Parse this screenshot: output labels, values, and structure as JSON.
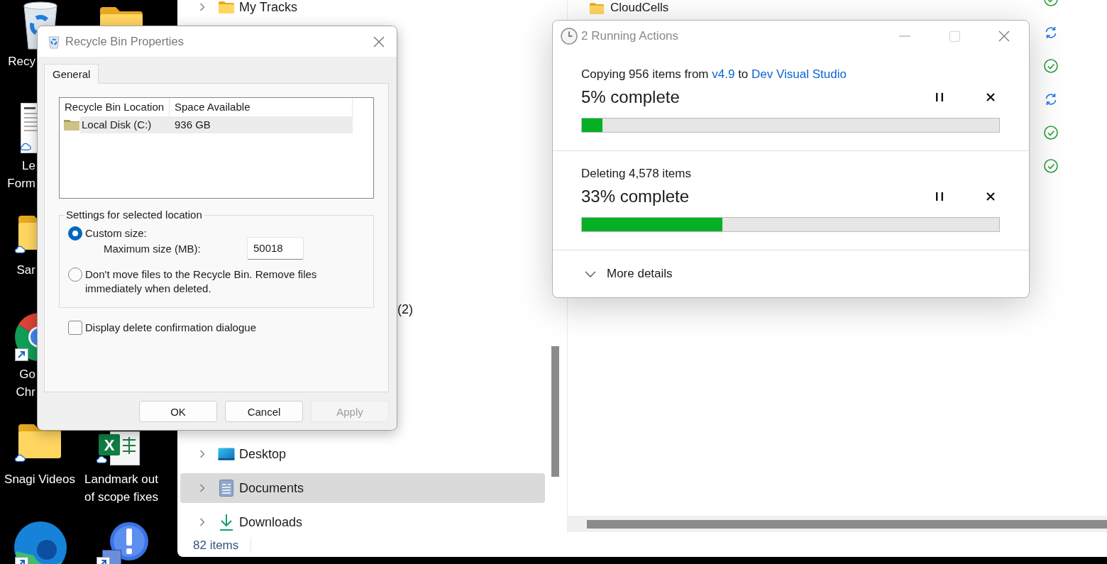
{
  "desktop": {
    "icons": [
      {
        "kind": "recycle-bin",
        "label": "Recy",
        "cloud": false,
        "shortcut": false
      },
      {
        "kind": "folder",
        "cloud": false,
        "shortcut": false
      },
      {
        "kind": "document",
        "label": "Le Form",
        "cloud": true,
        "shortcut": false
      },
      {
        "kind": "folder",
        "label": "Sar",
        "cloud": true,
        "shortcut": false
      },
      {
        "kind": "browser",
        "label": "Go Chr",
        "cloud": false,
        "shortcut": true
      },
      {
        "kind": "folder",
        "label": "Snagi Videos",
        "cloud": true,
        "shortcut": false
      },
      {
        "kind": "spreadsheet",
        "logo_text": "X",
        "label": "Landmark out of scope fixes",
        "cloud": true,
        "shortcut": false
      },
      {
        "kind": "edge",
        "cloud": false,
        "shortcut": true
      },
      {
        "kind": "alert",
        "cloud": false,
        "shortcut": true
      }
    ]
  },
  "explorer": {
    "nav_items": [
      {
        "kind": "folder",
        "label": "My Tracks",
        "selected": false
      },
      {
        "kind": "partial",
        "label": "(2)",
        "selected": false
      },
      {
        "kind": "desktop",
        "label": "Desktop",
        "selected": false
      },
      {
        "kind": "documents",
        "label": "Documents",
        "selected": true
      },
      {
        "kind": "downloads",
        "label": "Downloads",
        "selected": false
      }
    ],
    "files": [
      {
        "name": "CloudCells",
        "syncing": false
      },
      {
        "syncing": true
      },
      {
        "syncing": false
      },
      {
        "syncing": true
      },
      {
        "syncing": false
      },
      {
        "syncing": false
      }
    ],
    "status_bar": {
      "item_count": "82 items"
    }
  },
  "recycle_bin_properties": {
    "title": "Recycle Bin Properties",
    "tabs": [
      {
        "label": "General",
        "selected": true
      }
    ],
    "locations": {
      "columns": [
        "Recycle Bin Location",
        "Space Available"
      ],
      "rows": [
        {
          "cells": [
            "Local Disk (C:)",
            "936 GB"
          ],
          "selected": true
        }
      ]
    },
    "settings": {
      "legend": "Settings for selected location",
      "options": [
        {
          "label": "Custom size:",
          "selected": true
        },
        {
          "label": "Don't move files to the Recycle Bin. Remove files immediately when deleted.",
          "selected": false
        }
      ],
      "max_size": {
        "label": "Maximum size (MB):",
        "value": "50018"
      }
    },
    "confirm_checkbox": {
      "label": "Display delete confirmation dialogue",
      "checked": false
    },
    "buttons": [
      {
        "label": "OK",
        "disabled": false
      },
      {
        "label": "Cancel",
        "disabled": false
      },
      {
        "label": "Apply",
        "disabled": true
      }
    ]
  },
  "running_actions": {
    "title": "2 Running Actions",
    "actions": [
      {
        "description": [
          {
            "kind": "text",
            "text": "Copying 956 items from"
          },
          {
            "kind": "link",
            "text": "v4.9"
          },
          {
            "kind": "text",
            "text": "to"
          },
          {
            "kind": "link",
            "text": "Dev Visual Studio"
          }
        ],
        "progress_text": "5% complete",
        "level": 0.05
      },
      {
        "description": [
          {
            "kind": "text",
            "text": "Deleting 4,578 items"
          }
        ],
        "progress_text": "33% complete",
        "level": 0.336
      }
    ],
    "more_details": "More details"
  }
}
